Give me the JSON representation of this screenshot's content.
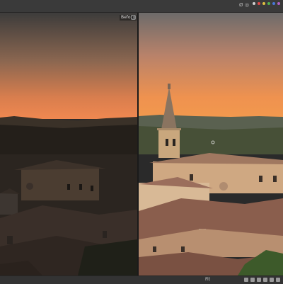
{
  "toolbar": {
    "top_tools": [
      "Ø",
      "◎"
    ],
    "color_labels": [
      "#d0d0d0",
      "#e04848",
      "#e0c040",
      "#50b050",
      "#4878d8",
      "#b060c0"
    ]
  },
  "compare": {
    "before_label": "Before",
    "before_icon": "split-view-icon"
  },
  "statusbar": {
    "zoom_value": "Fit"
  },
  "colors": {
    "sky_top_before": "#3d3c3b",
    "sky_horizon_before": "#f08850",
    "sky_top_after": "#6d6b6a",
    "sky_horizon_after": "#f2994e"
  }
}
